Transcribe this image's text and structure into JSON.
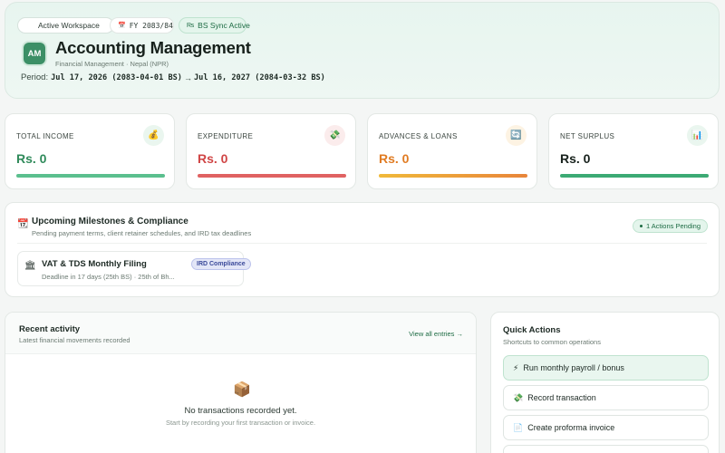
{
  "header": {
    "workspace_badge": "Active Workspace",
    "fiscal_year": "FY 2083/84",
    "sync_badge": "BS Sync Active",
    "avatar_initials": "AM",
    "title": "Accounting Management",
    "subtitle": "Financial Management · Nepal (NPR)",
    "period_label": "Period:",
    "period_start": "Jul 17, 2026 (2083-04-01 BS)",
    "period_end": "Jul 16, 2027 (2084-03-32 BS)"
  },
  "summary_cards": [
    {
      "label": "TOTAL INCOME",
      "value": "Rs. 0",
      "icon": "money-bag-icon",
      "color": "#2f8a5a",
      "bar_color": "#5bbf8e"
    },
    {
      "label": "EXPENDITURE",
      "value": "Rs. 0",
      "icon": "money-wings-icon",
      "color": "#d04545",
      "bar_color": "#e06262"
    },
    {
      "label": "ADVANCES & LOANS",
      "value": "Rs. 0",
      "icon": "refresh-icon",
      "color": "#e07b22",
      "bar_color": "#f0a935"
    },
    {
      "label": "NET SURPLUS",
      "value": "Rs. 0",
      "icon": "bar-chart-icon",
      "color": "#17211c",
      "bar_color": "#3caa74"
    }
  ],
  "milestones": {
    "title": "Upcoming Milestones & Compliance",
    "subtitle": "Pending payment terms, client retainer schedules, and IRD tax deadlines",
    "pending_badge": "1 Actions Pending",
    "items": [
      {
        "title": "VAT & TDS Monthly Filing",
        "detail": "Deadline in 17 days (25th BS) · 25th of Bh...",
        "tag": "IRD Compliance"
      }
    ]
  },
  "recent": {
    "title": "Recent activity",
    "subtitle": "Latest financial movements recorded",
    "view_all": "View all entries →",
    "empty_title": "No transactions recorded yet.",
    "empty_subtitle": "Start by recording your first transaction or invoice."
  },
  "quick_actions": {
    "title": "Quick Actions",
    "subtitle": "Shortcuts to common operations",
    "items": [
      {
        "label": "Run monthly payroll / bonus",
        "icon": "lightning-icon"
      },
      {
        "label": "Record transaction",
        "icon": "money-wings-icon"
      },
      {
        "label": "Create proforma invoice",
        "icon": "document-icon"
      }
    ]
  },
  "colors": {
    "accent": "#3c8f66",
    "income": "#2f8a5a",
    "expenditure": "#d04545",
    "advances": "#e07b22"
  }
}
